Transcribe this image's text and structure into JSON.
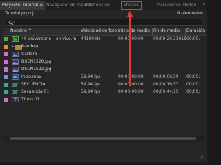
{
  "tabs": [
    {
      "label": "Proyecto: Tutorial ≡",
      "active": true
    },
    {
      "label": "Navegador de medios",
      "active": false
    },
    {
      "label": "Información",
      "active": false
    },
    {
      "label": "Efectos",
      "active": false
    },
    {
      "label": "Marcadores",
      "active": false
    },
    {
      "label": "Histori",
      "active": false
    }
  ],
  "tabs_overflow": "»",
  "project": {
    "file": "Tutorial.prproj",
    "count": "9 elementos"
  },
  "columns": [
    "Nombre",
    "Velocidad de foto",
    "Inicio de medio",
    "Fin de medio",
    "Duración"
  ],
  "items": [
    {
      "color": "#3fb23f",
      "icon": "audio-icon",
      "name": "40 aniversario – en vivo.m",
      "rate": "44100 Hz",
      "start": "00:00:00:00",
      "end": "00:09:20:23615",
      "dur": "00:09:"
    },
    {
      "color": "#e78a2a",
      "icon": "bin-icon",
      "name": "Bandeja",
      "rate": "",
      "start": "",
      "end": "",
      "dur": ""
    },
    {
      "color": "#d36bd3",
      "icon": "image-icon",
      "name": "Cartera",
      "rate": "",
      "start": "",
      "end": "",
      "dur": ""
    },
    {
      "color": "#d36bd3",
      "icon": "image-icon",
      "name": "DSCN1520.jpg",
      "rate": "",
      "start": "",
      "end": "",
      "dur": ""
    },
    {
      "color": "#d36bd3",
      "icon": "image-icon",
      "name": "DSCN1522.jpg",
      "rate": "",
      "start": "",
      "end": "",
      "dur": ""
    },
    {
      "color": "#7a8ce0",
      "icon": "video-icon",
      "name": "Intro.mov",
      "rate": "59,94 fps",
      "start": "00;00;00;00",
      "end": "00;00;06;59",
      "dur": "00;00;"
    },
    {
      "color": "#3aa6a6",
      "icon": "sequence-icon",
      "name": "SECUENCIA",
      "rate": "59,94 fps",
      "start": "00;00;00;00",
      "end": "00;00;16;57",
      "dur": "00;00;"
    },
    {
      "color": "#3aa6a6",
      "icon": "sequence-icon",
      "name": "Secuencia 01",
      "rate": "59,94 fps",
      "start": "00;00;00;00",
      "end": "00;09;44;15",
      "dur": "00;09;"
    },
    {
      "color": "#d36bd3",
      "icon": "title-icon",
      "name": "Título 01",
      "rate": "",
      "start": "",
      "end": "",
      "dur": ""
    }
  ],
  "colors": {
    "highlight": "#e23a3a"
  }
}
